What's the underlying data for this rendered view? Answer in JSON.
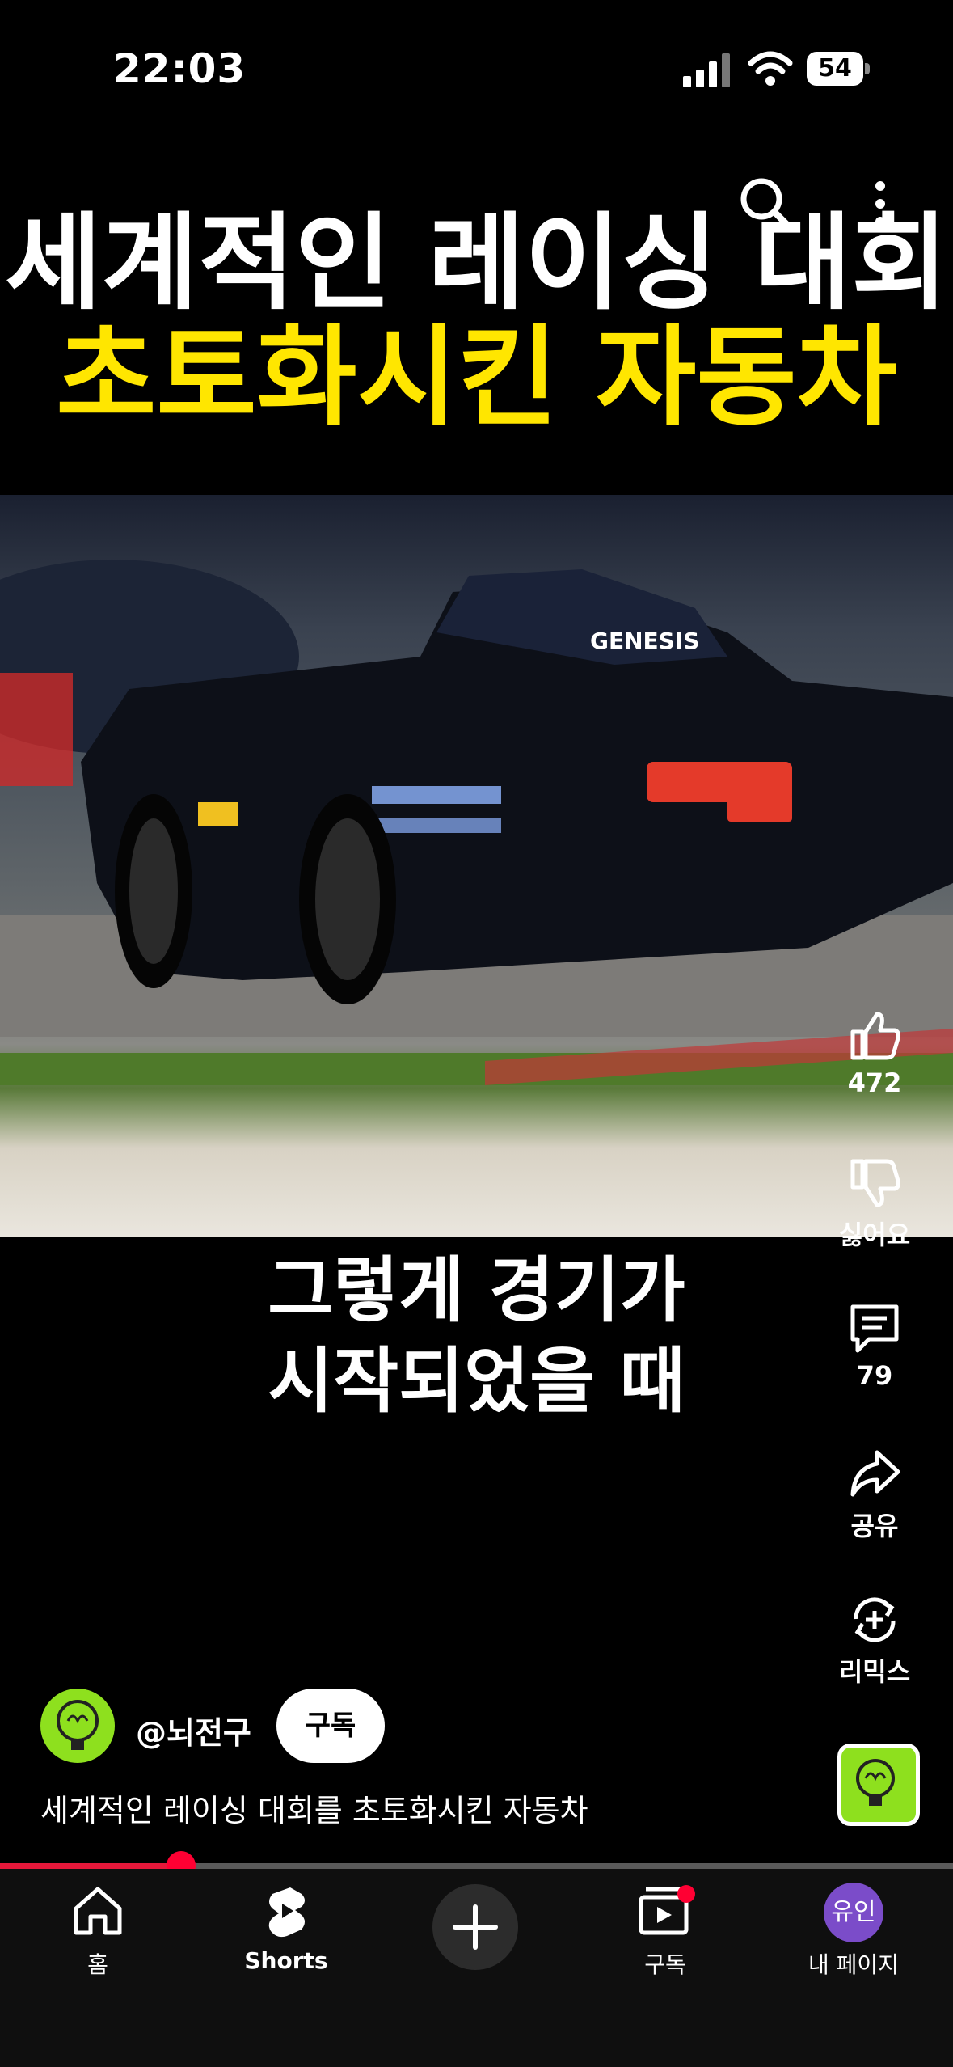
{
  "status_bar": {
    "time": "22:03",
    "battery": "54"
  },
  "video": {
    "title_line1": "세계적인 레이싱 대회",
    "title_line2": "초토화시킨 자동차",
    "subtitle_line1": "그렇게 경기가",
    "subtitle_line2": "시작되었을 때",
    "car_text": "GENESIS",
    "progress_fraction": 0.19
  },
  "actions": {
    "like_count": "472",
    "dislike_label": "싫어요",
    "comment_count": "79",
    "share_label": "공유",
    "remix_label": "리믹스"
  },
  "channel": {
    "handle": "@뇌전구",
    "subscribe_label": "구독",
    "description": "세계적인 레이싱 대회를 초토화시킨 자동차"
  },
  "nav": {
    "home": "홈",
    "shorts": "Shorts",
    "subscriptions": "구독",
    "my_page": "내 페이지",
    "my_avatar": "유인"
  },
  "colors": {
    "accent_red": "#ff0033",
    "title_yellow": "#ffe600",
    "avatar_green": "#8ee01e",
    "avatar_purple": "#7b4cc9"
  }
}
